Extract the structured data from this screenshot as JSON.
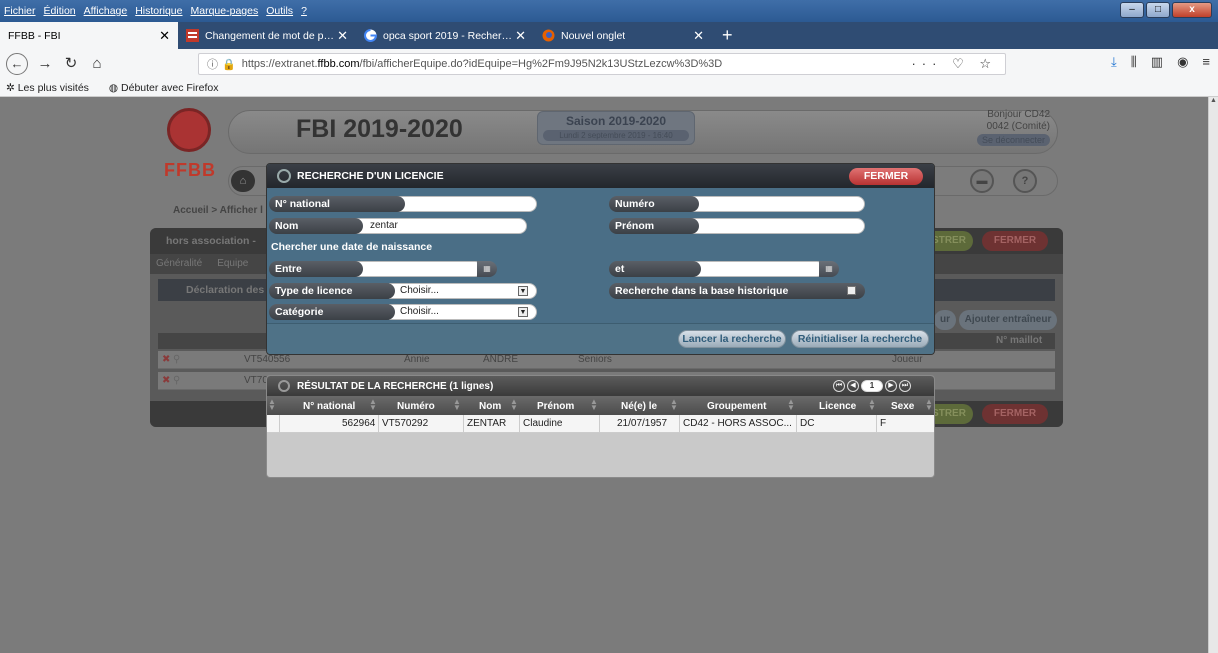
{
  "browser": {
    "menu": [
      "Fichier",
      "Édition",
      "Affichage",
      "Historique",
      "Marque-pages",
      "Outils",
      "?"
    ],
    "tabs": [
      {
        "label": "FFBB - FBI",
        "active": true
      },
      {
        "label": "Changement de mot de passe",
        "active": false
      },
      {
        "label": "opca sport 2019 - Recherche Google",
        "active": false
      },
      {
        "label": "Nouvel onglet",
        "active": false
      }
    ],
    "url_prefix": "https://extranet.",
    "url_domain": "ffbb.com",
    "url_path": "/fbi/afficherEquipe.do?idEquipe=Hg%2Fm9J95N2k13UStzLezcw%3D%3D",
    "bookmarks": [
      "Les plus visités",
      "Débuter avec Firefox"
    ]
  },
  "header": {
    "logo_text": "FFBB",
    "title": "FBI 2019-2020",
    "season": "Saison 2019-2020",
    "date": "Lundi 2 septembre 2019 - 16:40",
    "greeting": "Bonjour CD42",
    "user": "0042 (Comité)",
    "logout": "Se déconnecter",
    "help": "?"
  },
  "background_page": {
    "breadcrumb": "Accueil > Afficher l",
    "panel_title": "hors association -",
    "tabs": [
      "Généralité",
      "Equipe"
    ],
    "section": "Déclaration des l",
    "buttons": {
      "enregistrer": "STRER",
      "fermer": "FERMER",
      "joueur_fragment": "ur",
      "ajouter_entraineur": "Ajouter entraîneur"
    },
    "column_maillot": "N° maillot",
    "rows": [
      {
        "numero": "VT540556",
        "prenom": "Annie",
        "nom": "ANDRE",
        "categorie": "Seniors",
        "role": "Joueur"
      },
      {
        "numero": "VT70",
        "prenom": "",
        "nom": "",
        "categorie": "",
        "role": ""
      }
    ]
  },
  "search_modal": {
    "title": "RECHERCHE D'UN LICENCIE",
    "close_label": "FERMER",
    "fields": {
      "n_national": {
        "label": "N° national",
        "value": ""
      },
      "numero": {
        "label": "Numéro",
        "value": ""
      },
      "nom": {
        "label": "Nom",
        "value": "zentar"
      },
      "prenom": {
        "label": "Prénom",
        "value": ""
      },
      "date_section": "Chercher une date de naissance",
      "entre": {
        "label": "Entre",
        "value": ""
      },
      "et": {
        "label": "et",
        "value": ""
      },
      "type_licence": {
        "label": "Type de licence",
        "value": "Choisir..."
      },
      "historique": {
        "label": "Recherche dans la base historique"
      },
      "categorie": {
        "label": "Catégorie",
        "value": "Choisir..."
      }
    },
    "search_button": "Lancer la recherche",
    "reset_button": "Réinitialiser la recherche"
  },
  "results": {
    "title": "RÉSULTAT DE LA RECHERCHE (1 lignes)",
    "current_page": "1",
    "columns": [
      "N° national",
      "Numéro",
      "Nom",
      "Prénom",
      "Né(e) le",
      "Groupement",
      "Licence",
      "Sexe"
    ],
    "rows": [
      {
        "n_national": "562964",
        "numero": "VT570292",
        "nom": "ZENTAR",
        "prenom": "Claudine",
        "naissance": "21/07/1957",
        "groupement": "CD42 - HORS ASSOC...",
        "licence": "DC",
        "sexe": "F"
      }
    ]
  }
}
